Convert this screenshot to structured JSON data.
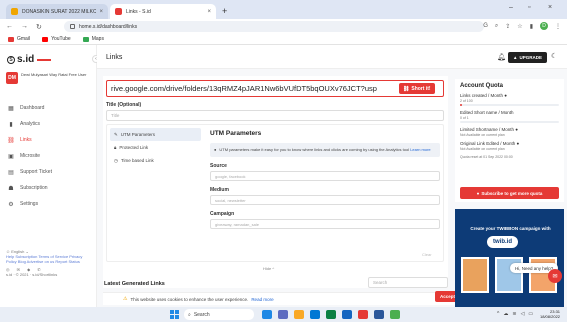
{
  "browser": {
    "tabs": [
      {
        "title": "DONASIKIN SURAT 2022 MILKC",
        "favicon_color": "#f0a500"
      },
      {
        "title": "Links - S.id",
        "favicon_color": "#e53935"
      }
    ],
    "new_tab": "+",
    "url": "home.s.id/dashboard/links",
    "bookmarks": [
      {
        "label": "Gmail",
        "color": "#e53935"
      },
      {
        "label": "YouTube",
        "color": "#ff0000"
      },
      {
        "label": "Maps",
        "color": "#34a853"
      }
    ],
    "profile_initial": "D"
  },
  "sidebar": {
    "logo": "s.id",
    "user": {
      "initials": "DM",
      "name": "Dewi Mulyasari Way Ratai Free User"
    },
    "items": [
      {
        "label": "Dashboard",
        "icon": "dashboard-icon"
      },
      {
        "label": "Analytics",
        "icon": "analytics-icon"
      },
      {
        "label": "Links",
        "icon": "link-icon",
        "active": true
      },
      {
        "label": "Microsite",
        "icon": "microsite-icon"
      },
      {
        "label": "Support Ticket",
        "icon": "support-icon"
      },
      {
        "label": "Subscription",
        "icon": "subscription-icon"
      },
      {
        "label": "Settings",
        "icon": "settings-icon"
      }
    ],
    "footer": {
      "language": "English",
      "links": "Help  Subscription  Terms of Service  Privacy Policy  Blog  Advertise on us  Report  Status",
      "copyright": "s.id · © 2021 · s.id/Shortlinks"
    }
  },
  "header": {
    "title": "Links",
    "upgrade_label": "UPGRADE"
  },
  "form": {
    "url_value": "rive.google.com/drive/folders/13qRMZ4pJAR1Nw6bVUfDT5bqOUXv76JCT?usp",
    "short_button": "Short it!",
    "title_label": "Title (Optional)",
    "title_placeholder": "Title",
    "utm_tabs": [
      "UTM Parameters",
      "Protected Link",
      "Time based Link"
    ],
    "utm_title": "UTM Parameters",
    "utm_info": "UTM parameters make it easy for you to know where links and clicks are coming by using the Analytics tool",
    "utm_info_link": "Learn more",
    "source_label": "Source",
    "source_placeholder": "google, facebook",
    "medium_label": "Medium",
    "medium_placeholder": "social, newsletter",
    "campaign_label": "Campaign",
    "campaign_placeholder": "giveaway, ramadan_sale",
    "clear_label": "Clear",
    "hide_label": "Hide ^"
  },
  "latest": {
    "title": "Latest Generated Links",
    "search_placeholder": "Search"
  },
  "cookie": {
    "text": "This website uses cookies to enhance the user experience.",
    "link": "Read more",
    "accept": "Accept"
  },
  "quota": {
    "title": "Account Quota",
    "rows": [
      {
        "label": "Links created / Month",
        "sub": "2 of 100",
        "progress": 0.02
      },
      {
        "label": "Edited Short name / Month",
        "sub": "0 of 1",
        "progress": 0
      },
      {
        "label": "Limited Shortname / Month",
        "sub": "Not Available on current plan"
      },
      {
        "label": "Original Link Edited / Month",
        "sub": "Not Available on current plan"
      }
    ],
    "reset_note": "Quota reset at 01 Sep 2022 00:00",
    "button": "Subscribe to get more quota"
  },
  "promo": {
    "text": "Create your TWIBBON campaign with",
    "brand": "twib.id"
  },
  "chat": {
    "bubble": "Hi, Need any help?"
  },
  "taskbar": {
    "search": "Search",
    "time": "23:31",
    "date": "18/08/2022"
  },
  "colors": {
    "accent": "#e53935",
    "dark": "#212121",
    "promo_bg": "#0d3b77"
  }
}
